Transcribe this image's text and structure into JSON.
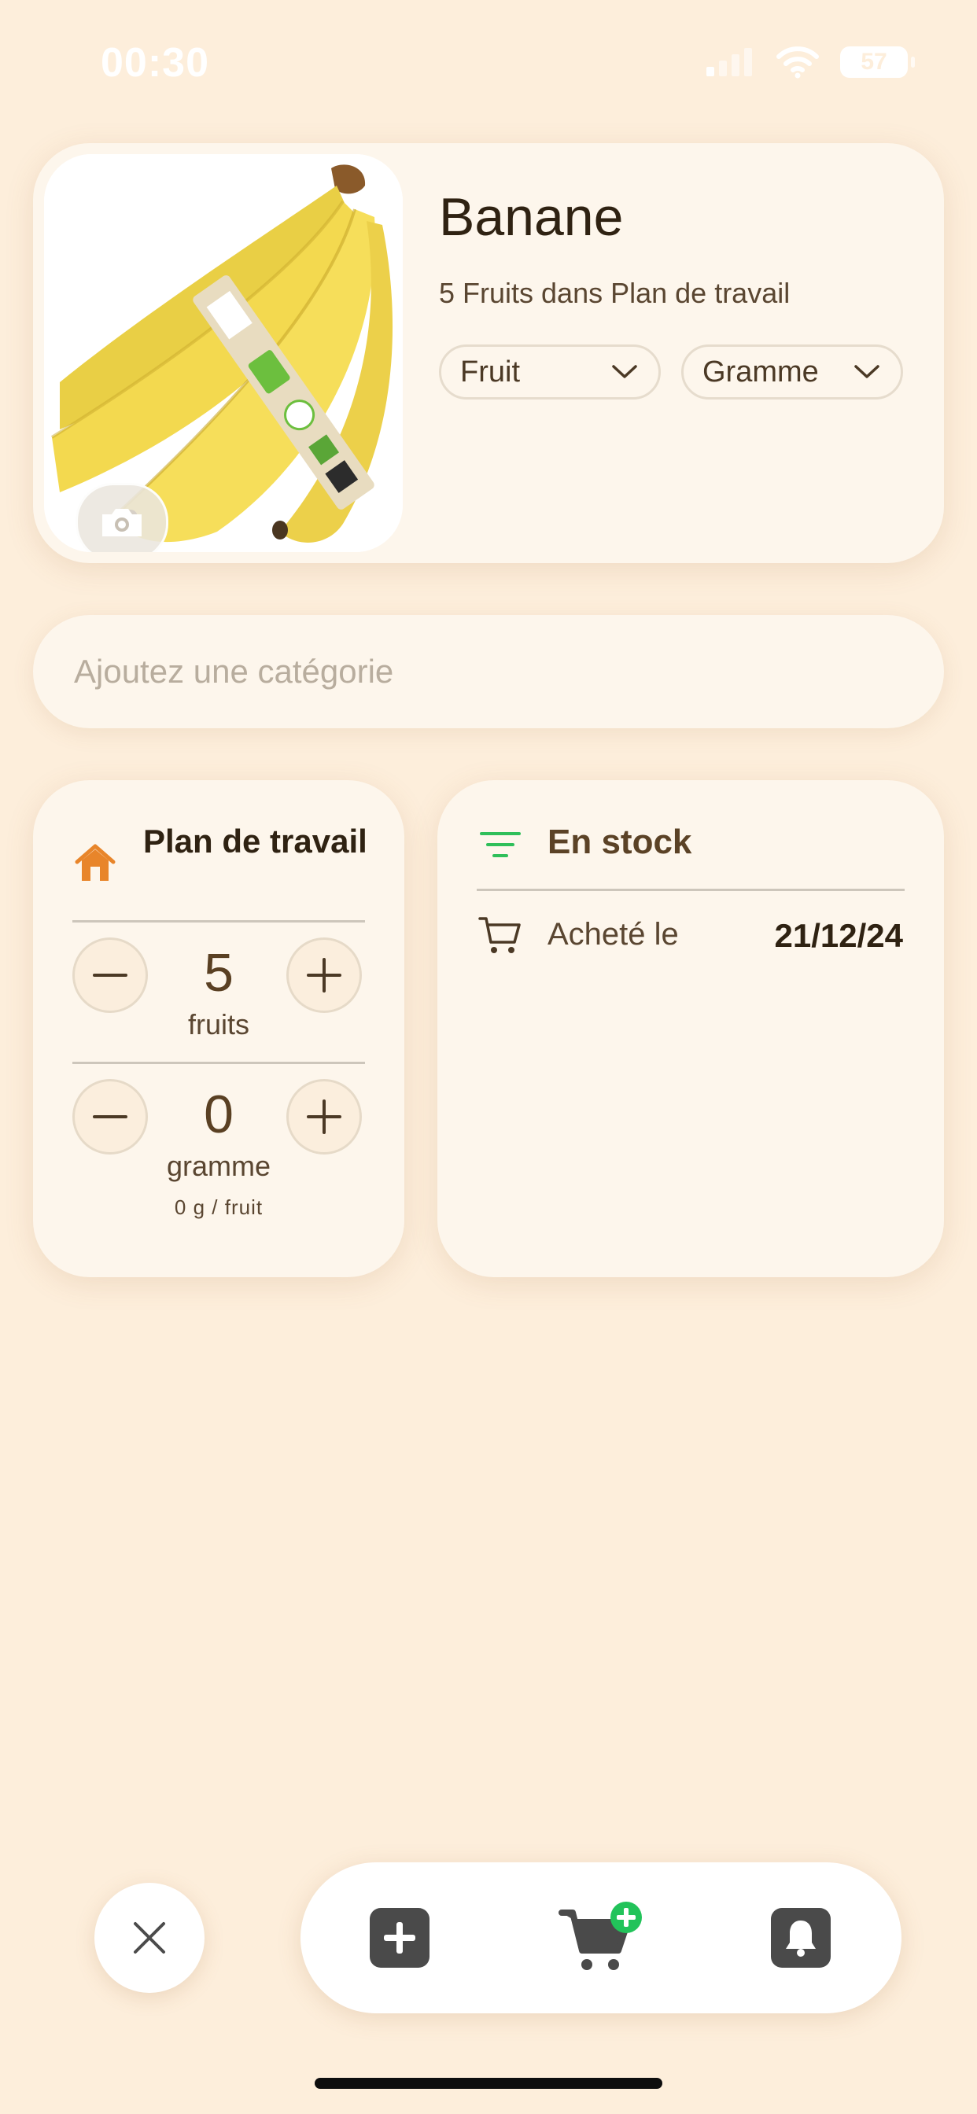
{
  "status_bar": {
    "time": "00:30",
    "battery": "57"
  },
  "product": {
    "name": "Banane",
    "subtitle": "5 Fruits dans Plan de travail",
    "type_select": "Fruit",
    "unit_select": "Gramme"
  },
  "category": {
    "placeholder": "Ajoutez une catégorie"
  },
  "location_card": {
    "title": "Plan de travail",
    "count_value": "5",
    "count_unit": "fruits",
    "weight_value": "0",
    "weight_unit": "gramme",
    "ratio": "0 g / fruit"
  },
  "stock_card": {
    "status": "En stock",
    "bought_label": "Acheté le",
    "bought_date": "21/12/24"
  },
  "colors": {
    "background": "#fdeedb",
    "card": "#fdf6ec",
    "home_icon": "#e8852a",
    "filter_icon": "#2fbf5a",
    "badge_green": "#22c35a"
  }
}
